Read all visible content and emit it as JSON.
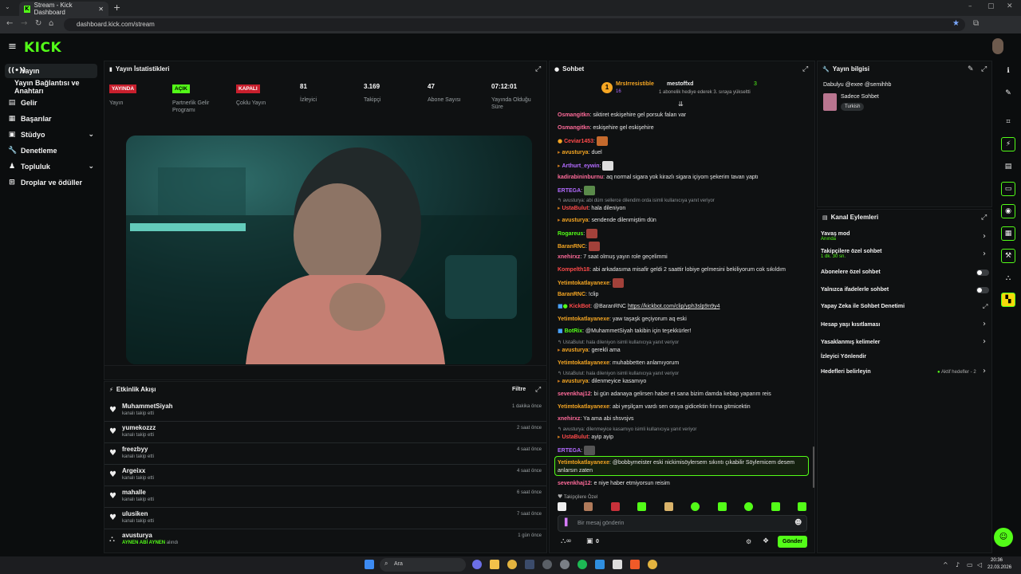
{
  "browser": {
    "tab_title": "Stream - Kick Dashboard",
    "url": "dashboard.kick.com/stream"
  },
  "brand": {
    "logo": "KICK",
    "accent": "#53fc18"
  },
  "sidebar": {
    "items": [
      {
        "label": "Yayın",
        "icon": "broadcast-icon"
      },
      {
        "label": "Yayın Bağlantısı ve Anahtarı",
        "icon": "key-icon"
      },
      {
        "label": "Gelir",
        "icon": "money-icon"
      },
      {
        "label": "Başarılar",
        "icon": "trophy-icon"
      },
      {
        "label": "Stüdyo",
        "icon": "studio-icon"
      },
      {
        "label": "Denetleme",
        "icon": "wrench-icon"
      },
      {
        "label": "Topluluk",
        "icon": "community-icon"
      },
      {
        "label": "Droplar ve ödüller",
        "icon": "gift-icon"
      }
    ]
  },
  "stats": {
    "title": "Yayın İstatistikleri",
    "items": [
      {
        "value": "YAYINDA",
        "label": "Yayın",
        "style": "red"
      },
      {
        "value": "AÇIK",
        "label": "Partnerlik Gelir Programı",
        "style": "green"
      },
      {
        "value": "KAPALI",
        "label": "Çoklu Yayın",
        "style": "red"
      },
      {
        "value": "81",
        "label": "İzleyici",
        "style": "num"
      },
      {
        "value": "3.169",
        "label": "Takipçi",
        "style": "num"
      },
      {
        "value": "47",
        "label": "Abone Sayısı",
        "style": "num"
      },
      {
        "value": "07:12:01",
        "label": "Yayında Olduğu Süre",
        "style": "num"
      }
    ]
  },
  "activity": {
    "title": "Etkinlik Akışı",
    "filter": "Filtre",
    "rows": [
      {
        "user": "MuhammetSiyah",
        "action": "kanalı takip etti",
        "time": "1 dakika önce"
      },
      {
        "user": "yumekozzz",
        "action": "kanalı takip etti",
        "time": "2 saat önce"
      },
      {
        "user": "freezbyy",
        "action": "kanalı takip etti",
        "time": "4 saat önce"
      },
      {
        "user": "Argeixx",
        "action": "kanalı takip etti",
        "time": "4 saat önce"
      },
      {
        "user": "mahalle",
        "action": "kanalı takip etti",
        "time": "6 saat önce"
      },
      {
        "user": "ulusiken",
        "action": "kanalı takip etti",
        "time": "7 saat önce"
      },
      {
        "user": "avusturya",
        "action_highlight": "AYNEN ABİ AYNEN",
        "action": "alındı",
        "time": "1 gün önce"
      }
    ]
  },
  "chat": {
    "title": "Sohbet",
    "pinned": {
      "gifter": "MrsIrresistible",
      "gifter_count": "16",
      "recipient": "mestoffxd",
      "count": "3",
      "note": "1 abonelik hediye ederek 3. sıraya yükseltti"
    },
    "messages": [
      {
        "user": "Osmangitkn",
        "color": "#ff6b9a",
        "text": "siktiret eskişehire gel porsuk falan var"
      },
      {
        "user": "Osmangitkn",
        "color": "#ff6b9a",
        "text": "eskişehire gel eskişehire"
      },
      {
        "user": "Ceviar1453",
        "color": "#ff4a4a",
        "text": ""
      },
      {
        "user": "avusturya",
        "color": "#f5a623",
        "text": "duel"
      },
      {
        "user": "Arthurt_eywin",
        "color": "#b36bff",
        "text": ""
      },
      {
        "user": "kadirabininburnu",
        "color": "#ff6b9a",
        "text": "aq normal sigara yok kirazlı sigara içiyom şekerim tavan yaptı"
      },
      {
        "user": "ERTEGA",
        "color": "#b36bff",
        "text": ""
      },
      {
        "reply": "avusturya: abi düm sellerce dilendim orda isimli kullanıcıya yanıt veriyor"
      },
      {
        "user": "UstaBulut",
        "color": "#ff4a4a",
        "text": "hala dileniyon"
      },
      {
        "user": "avusturya",
        "color": "#f5a623",
        "text": "sendende dilenmiştim dün"
      },
      {
        "user": "Rogareus",
        "color": "#53fc18",
        "text": ""
      },
      {
        "user": "BaranRNC",
        "color": "#f5a623",
        "text": ""
      },
      {
        "user": "xnehirxz",
        "color": "#ff6b9a",
        "text": "7 saat olmuş yayın role geçelimmi"
      },
      {
        "user": "Kompelth18",
        "color": "#ff4a4a",
        "text": "abi arkadasıma misafir geldi 2 saattir lobiye gelmesini bekiliyorum cok sıkıldım"
      },
      {
        "user": "Yetimtokatlayanexe",
        "color": "#f5a623",
        "text": ""
      },
      {
        "user": "BaranRNC",
        "color": "#f5a623",
        "text": "!clip"
      },
      {
        "user": "KickBot",
        "color": "#ff4a4a",
        "text": "@BaranRNC",
        "link": "https://kickbot.com/clip/yph3slp9n9y4"
      },
      {
        "user": "Yetimtokatlayanexe",
        "color": "#f5a623",
        "text": "yaw taşaşk geçiyorum aq eski"
      },
      {
        "user": "BotRix",
        "color": "#53fc18",
        "text": "@MuhammetSiyah takibin için teşekkürler!"
      },
      {
        "reply": "UstaBulut: hala dileniyon isimli kullanıcıya yanıt veriyor"
      },
      {
        "user": "avusturya",
        "color": "#f5a623",
        "text": "gerekli ama"
      },
      {
        "user": "Yetimtokatlayanexe",
        "color": "#f5a623",
        "text": "muhabbetten anlamıyorum"
      },
      {
        "reply": "UstaBulut: hala dileniyon isimli kullanıcıya yanıt veriyor"
      },
      {
        "user": "avusturya",
        "color": "#f5a623",
        "text": "dilenmeyice kasamıyo"
      },
      {
        "user": "sevenkhaj12",
        "color": "#ff6b9a",
        "text": "bi gün adanaya gelirsen haber et sana bizim damda kebap yaparım reis"
      },
      {
        "user": "Yetimtokatlayanexe",
        "color": "#f5a623",
        "text": "abi yeşilçam vardı sen oraya gidicektin fırına gitmicektin"
      },
      {
        "user": "xnehirxz",
        "color": "#ff6b9a",
        "text": "Ya ama abi shsvsjvs"
      },
      {
        "reply": "avusturya: dilenmeyice kasamıyo isimli kullanıcıya yanıt veriyor"
      },
      {
        "user": "UstaBulut",
        "color": "#ff4a4a",
        "text": "ayip ayip"
      },
      {
        "user": "ERTEGA",
        "color": "#b36bff",
        "text": ""
      },
      {
        "user": "Yetimtokatlayanexe",
        "color": "#f5a623",
        "text": "@bobbymeister eski nickimisöylersem sıkıntı çıkabilir Söylemicem desem",
        "cont": "anlarsın zaten",
        "highlight": true
      },
      {
        "user": "sevenkhaj12",
        "color": "#ff6b9a",
        "text": "e niye haber etmiyorsun reisim"
      }
    ],
    "followers_only_label": "Takipçilere Özel",
    "input_placeholder": "Bir mesaj gönderin",
    "points": "0",
    "send_label": "Gönder"
  },
  "stream_info": {
    "title": "Yayın bilgisi",
    "stream_title": "Dabulyu @exee @semihhb",
    "category": "Sadece Sohbet",
    "tag": "Turkish"
  },
  "channel_actions": {
    "title": "Kanal Eylemleri",
    "items": [
      {
        "label": "Yavaş mod",
        "sub": "Anında",
        "control": "arrow"
      },
      {
        "label": "Takipçilere özel sohbet",
        "sub": "1 dk. 30 sn.",
        "control": "arrow"
      },
      {
        "label": "Abonelere özel sohbet",
        "control": "toggle"
      },
      {
        "label": "Yalnızca ifadelerle sohbet",
        "control": "toggle"
      },
      {
        "label": "Yapay Zeka ile Sohbet Denetimi",
        "control": "external"
      },
      {
        "label": "Hesap yaşı kısıtlaması",
        "control": "arrow"
      },
      {
        "label": "Yasaklanmış kelimeler",
        "control": "arrow"
      },
      {
        "label": "İzleyici Yönlendir",
        "control": "none"
      },
      {
        "label": "Hedefleri belirleyin",
        "extra": "Aktif hedefler - 2",
        "control": "arrow"
      }
    ]
  },
  "taskbar": {
    "search": "Ara",
    "time": "20:36",
    "date": "22.03.2026"
  }
}
